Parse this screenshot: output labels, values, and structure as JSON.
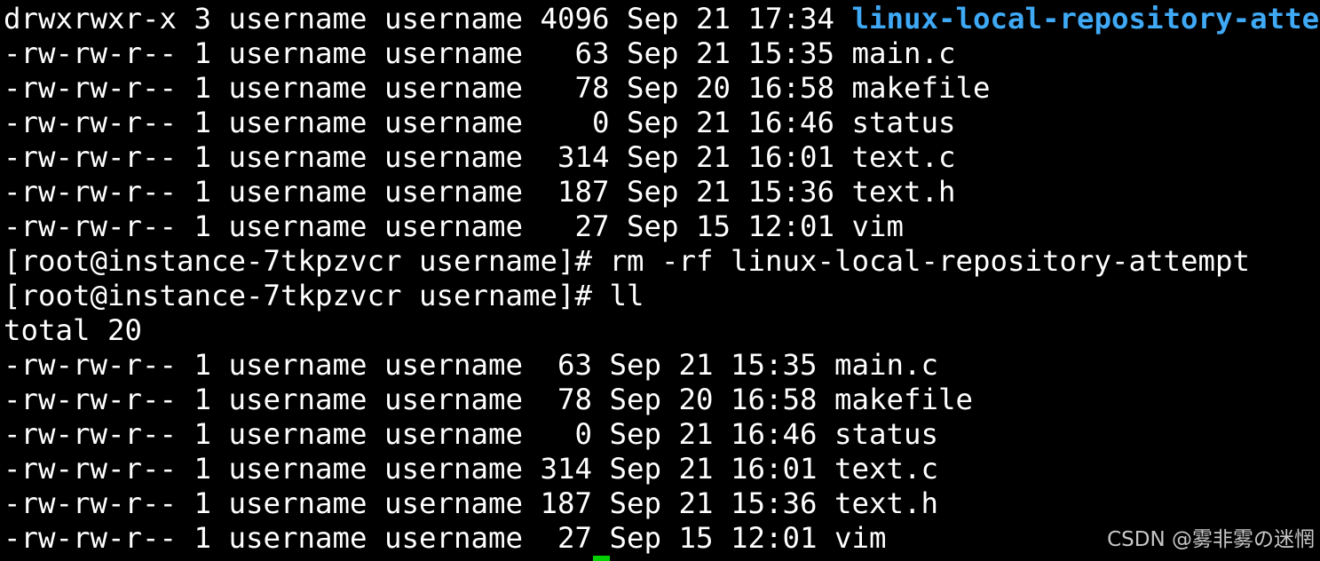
{
  "terminal": {
    "listing_before": {
      "dir_entry": {
        "prefix": "drwxrwxr-x 3 username username 4096 Sep 21 17:34 ",
        "name": "linux-local-repository-attempt"
      },
      "files": [
        "-rw-rw-r-- 1 username username   63 Sep 21 15:35 main.c",
        "-rw-rw-r-- 1 username username   78 Sep 20 16:58 makefile",
        "-rw-rw-r-- 1 username username    0 Sep 21 16:46 status",
        "-rw-rw-r-- 1 username username  314 Sep 21 16:01 text.c",
        "-rw-rw-r-- 1 username username  187 Sep 21 15:36 text.h",
        "-rw-rw-r-- 1 username username   27 Sep 15 12:01 vim"
      ]
    },
    "commands": [
      "[root@instance-7tkpzvcr username]# rm -rf linux-local-repository-attempt",
      "[root@instance-7tkpzvcr username]# ll"
    ],
    "total": "total 20",
    "listing_after": [
      "-rw-rw-r-- 1 username username  63 Sep 21 15:35 main.c",
      "-rw-rw-r-- 1 username username  78 Sep 20 16:58 makefile",
      "-rw-rw-r-- 1 username username   0 Sep 21 16:46 status",
      "-rw-rw-r-- 1 username username 314 Sep 21 16:01 text.c",
      "-rw-rw-r-- 1 username username 187 Sep 21 15:36 text.h",
      "-rw-rw-r-- 1 username username  27 Sep 15 12:01 vim"
    ],
    "colors": {
      "background": "#000000",
      "text": "#ffffff",
      "directory": "#3fa9f5",
      "cursor": "#00d000"
    }
  },
  "watermark": "CSDN @雾非雾の迷惘"
}
